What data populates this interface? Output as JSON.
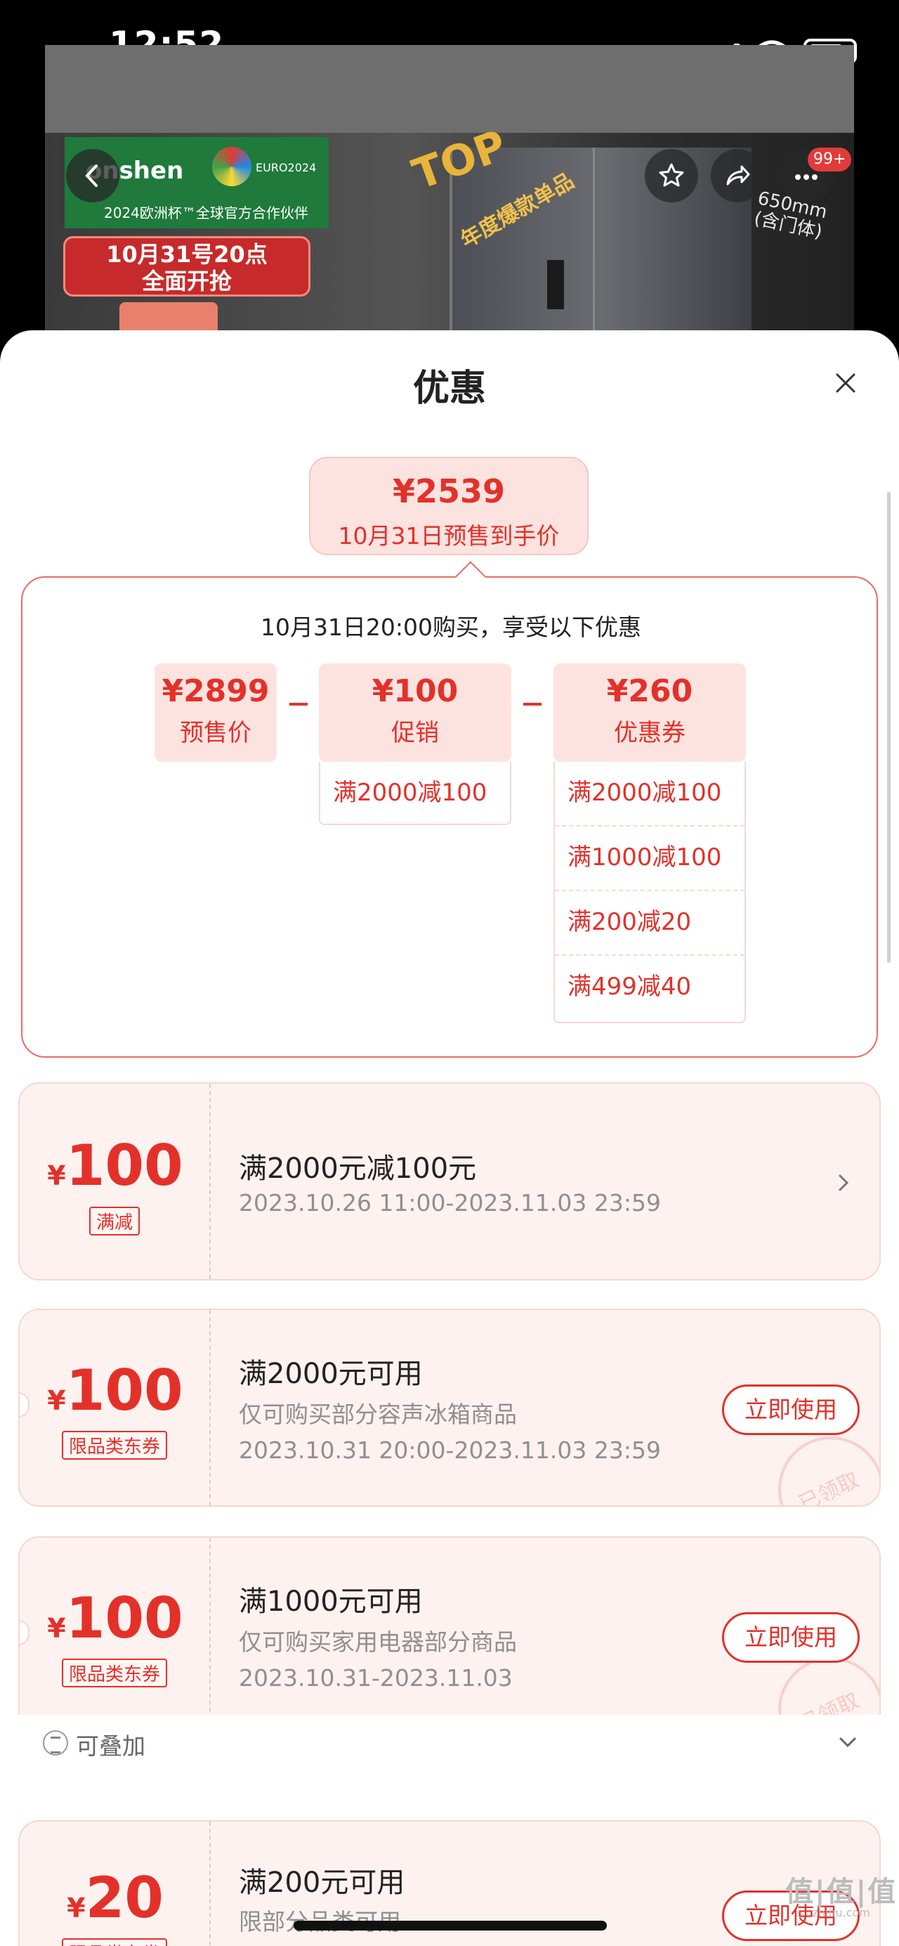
{
  "status": {
    "time": "12:52"
  },
  "product": {
    "brand": "onshen",
    "euro_label": "EURO2024",
    "brand_sub": "2024欧洲杯™全球官方合作伙伴",
    "promo_line1": "10月31号20点",
    "promo_line2": "全面开抢",
    "top_badge": "TOP",
    "top_badge_sub": "年度爆款单品",
    "size_line1": "650mm",
    "size_line2": "(含门体)",
    "cart_count": "99+"
  },
  "sheet": {
    "title": "优惠",
    "final_price": "¥2539",
    "final_price_desc": "10月31日预售到手价",
    "breakdown_title": "10月31日20:00购买，享受以下优惠",
    "presale": {
      "value": "¥2899",
      "label": "预售价"
    },
    "promotion": {
      "value": "¥100",
      "label": "促销",
      "items": [
        "满2000减100"
      ]
    },
    "coupons_total": {
      "value": "¥260",
      "label": "优惠券",
      "items": [
        "满2000减100",
        "满1000减100",
        "满200减20",
        "满499减40"
      ]
    }
  },
  "coupons": [
    {
      "yen": "¥",
      "amount": "100",
      "tag": "满减",
      "title": "满2000元减100元",
      "lines": [
        "2023.10.26 11:00-2023.11.03 23:59"
      ],
      "action": ""
    },
    {
      "yen": "¥",
      "amount": "100",
      "tag": "限品类东券",
      "title": "满2000元可用",
      "lines": [
        "仅可购买部分容声冰箱商品",
        "2023.10.31 20:00-2023.11.03 23:59"
      ],
      "action": "立即使用",
      "stamp": "已领取"
    },
    {
      "yen": "¥",
      "amount": "100",
      "tag": "限品类东券",
      "title": "满1000元可用",
      "lines": [
        "仅可购买家用电器部分商品",
        "2023.10.31-2023.11.03"
      ],
      "action": "立即使用",
      "stamp": "已领取"
    },
    {
      "yen": "¥",
      "amount": "20",
      "tag": "限品类东券",
      "title": "满200元可用",
      "lines": [
        "限部分品类可用"
      ],
      "action": "立即使用"
    }
  ],
  "stackable_label": "可叠加",
  "watermark": {
    "main": "值|值|值",
    "sub": "zhihu.com"
  },
  "colors": {
    "accent": "#e3312a",
    "pill_bg": "#fde3e0",
    "card_bg": "#fef2f0"
  }
}
